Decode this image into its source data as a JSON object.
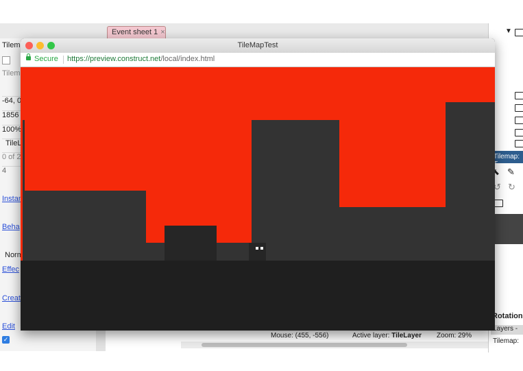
{
  "editor": {
    "tab_label": "Event sheet 1",
    "tab_close": "×",
    "left_panel": {
      "title": "Tilem",
      "item1": "Tilem",
      "position": "-64, 0",
      "size": "1856",
      "opacity": "100%",
      "layer": "TileL",
      "count": "0 of 2",
      "value": "4",
      "links": [
        "Instan",
        "Beha",
        "Effec",
        "Creat",
        "Edit"
      ],
      "normal": "Norm"
    },
    "right_panel": {
      "tilemap_label": "Tilemap: T",
      "rotation_label": "Rotation",
      "layers_label": "Layers - ",
      "tilemap_row": "Tilemap:"
    },
    "status": {
      "mouse": "Mouse: (455, -556)",
      "active_layer_label": "Active layer:",
      "active_layer_value": "TileLayer",
      "zoom": "Zoom: 29%"
    }
  },
  "browser": {
    "title": "TileMapTest",
    "secure_label": "Secure",
    "url_host": "https://preview.construct.net",
    "url_path": "/local/index.html",
    "traffic_colors": [
      "#fc5f57",
      "#fdbc2e",
      "#33c748"
    ]
  },
  "game": {
    "sky_color": "#f5290a",
    "mid_color": "#333333",
    "ground_color": "#1f1f1f",
    "block_color": "#262626",
    "player_eye_color": "#ffffff"
  }
}
